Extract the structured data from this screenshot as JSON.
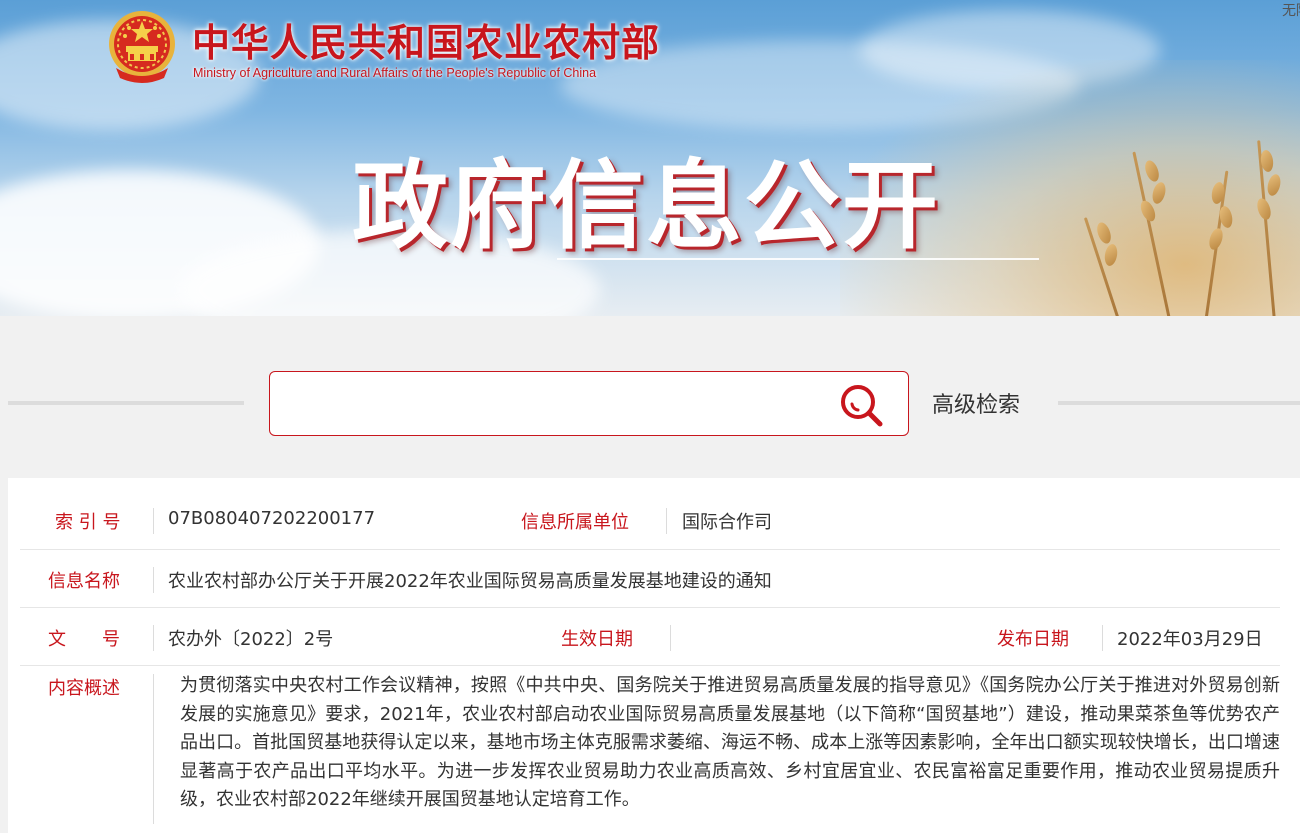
{
  "header": {
    "ministry_cn": "中华人民共和国农业农村部",
    "ministry_en": "Ministry of Agriculture and Rural Affairs of the People's Republic of China",
    "top_right_link": "无障",
    "section_title": "政府信息公开"
  },
  "search": {
    "placeholder": "",
    "advanced_label": "高级检索"
  },
  "info": {
    "index_label": "索 引 号",
    "index_value": "07B080407202200177",
    "unit_label": "信息所属单位",
    "unit_value": "国际合作司",
    "name_label": "信息名称",
    "name_value": "农业农村部办公厅关于开展2022年农业国际贸易高质量发展基地建设的通知",
    "doc_label": "文　　号",
    "doc_value": "农办外〔2022〕2号",
    "effective_label": "生效日期",
    "effective_value": "",
    "publish_label": "发布日期",
    "publish_value": "2022年03月29日",
    "summary_label": "内容概述",
    "summary_value": "为贯彻落实中央农村工作会议精神，按照《中共中央、国务院关于推进贸易高质量发展的指导意见》《国务院办公厅关于推进对外贸易创新发展的实施意见》要求，2021年，农业农村部启动农业国际贸易高质量发展基地（以下简称“国贸基地”）建设，推动果菜茶鱼等优势农产品出口。首批国贸基地获得认定以来，基地市场主体克服需求萎缩、海运不畅、成本上涨等因素影响，全年出口额实现较快增长，出口增速显著高于农产品出口平均水平。为进一步发挥农业贸易助力农业高质高效、乡村宜居宜业、农民富裕富足重要作用，推动农业贸易提质升级，农业农村部2022年继续开展国贸基地认定培育工作。"
  },
  "colors": {
    "accent_red": "#c8161d",
    "page_bg": "#f1f1f1"
  }
}
